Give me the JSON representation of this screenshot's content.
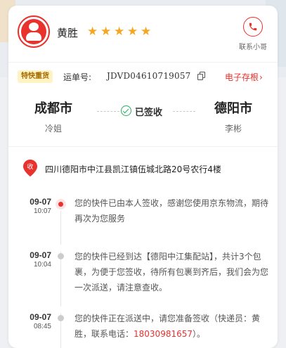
{
  "courier": {
    "name": "黄胜",
    "rating_stars": 5,
    "contact_label": "联系小哥"
  },
  "waybill": {
    "badge": "特快重货",
    "label": "运单号:",
    "number": "JDVD04610719057",
    "evidence_label": "电子存根",
    "evidence_chevron": "›"
  },
  "route": {
    "from_city": "成都市",
    "from_person": "冷姐",
    "status": "已签收",
    "to_city": "德阳市",
    "to_person": "李彬"
  },
  "address": {
    "pin_label": "收",
    "text": "四川德阳市中江县凯江镇伍城北路20号农行4楼"
  },
  "timeline": [
    {
      "date": "09-07",
      "time": "10:07",
      "text": "您的快件已由本人签收，感谢您使用京东物流，期待再次为您服务"
    },
    {
      "date": "09-07",
      "time": "10:04",
      "text": "您的快件已经到达【德阳中江集配站】，共计3个包裹，为便于您签收，待所有包裹到齐后，我们会为您一次派送，请注意查收。"
    },
    {
      "date": "09-07",
      "time": "08:45",
      "text_before": "您的快件正在派送中，请您准备签收（快递员：黄胜，联系电话：",
      "phone": "18030981657",
      "text_after": "）。"
    }
  ],
  "colors": {
    "accent": "#e9312d",
    "star": "#f5a623",
    "signed_green": "#27ae60",
    "badge_bg": "#fff3c4"
  },
  "icons": {
    "avatar": "jd-courier-avatar",
    "phone": "phone-icon",
    "copy": "copy-icon",
    "status": "check-circle-icon",
    "pin": "location-pin-icon",
    "star": "star-icon"
  }
}
